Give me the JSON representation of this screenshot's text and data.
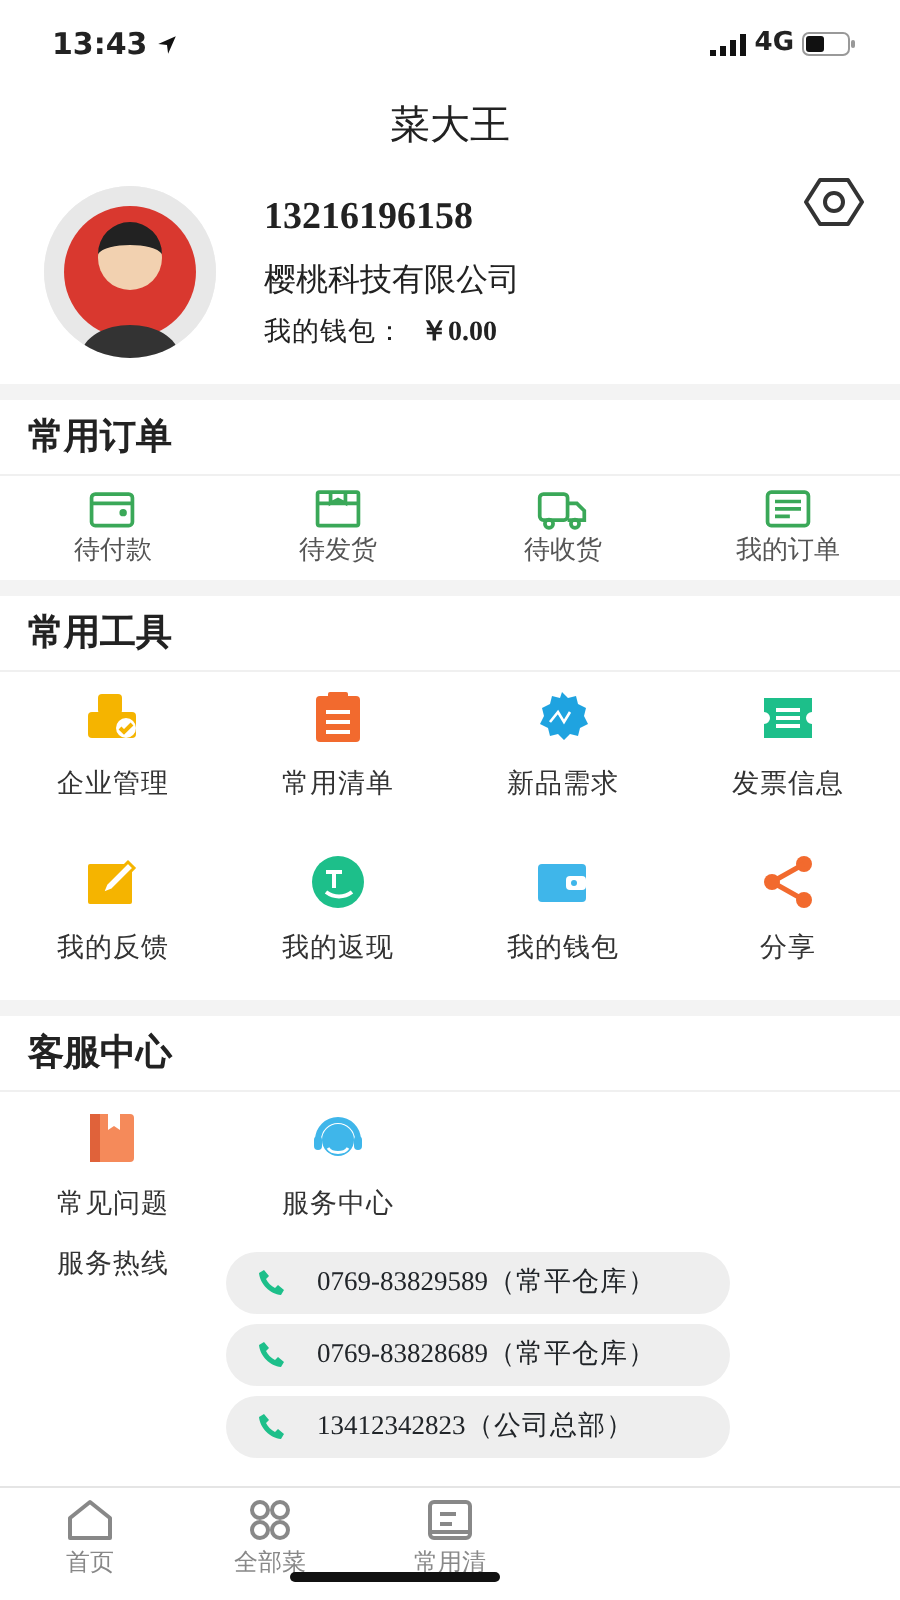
{
  "status_bar": {
    "time": "13:43",
    "network": "4G"
  },
  "title": "菜大王",
  "profile": {
    "phone": "13216196158",
    "company": "樱桃科技有限公司",
    "wallet_label": "我的钱包：",
    "wallet_value": "￥0.00"
  },
  "orders": {
    "heading": "常用订单",
    "items": [
      {
        "label": "待付款",
        "kind": "card"
      },
      {
        "label": "待发货",
        "kind": "box"
      },
      {
        "label": "待收货",
        "kind": "truck"
      },
      {
        "label": "我的订单",
        "kind": "list"
      }
    ]
  },
  "tools": {
    "heading": "常用工具",
    "items": [
      {
        "label": "企业管理",
        "kind": "building",
        "color": "#f5b400"
      },
      {
        "label": "常用清单",
        "kind": "clipboard",
        "color": "#f26a2e"
      },
      {
        "label": "新品需求",
        "kind": "new",
        "color": "#1fa3e0"
      },
      {
        "label": "发票信息",
        "kind": "ticket",
        "color": "#1dbf8a"
      },
      {
        "label": "我的反馈",
        "kind": "pencil",
        "color": "#f5b400"
      },
      {
        "label": "我的返现",
        "kind": "cashback",
        "color": "#1dbf8a"
      },
      {
        "label": "我的钱包",
        "kind": "wallet",
        "color": "#3fb6ea"
      },
      {
        "label": "分享",
        "kind": "share",
        "color": "#f26a2e"
      }
    ]
  },
  "service": {
    "heading": "客服中心",
    "items": [
      {
        "label": "常见问题",
        "kind": "book",
        "color": "#f58a5a"
      },
      {
        "label": "服务中心",
        "kind": "agent",
        "color": "#3fb6ea"
      }
    ],
    "hotline_label": "服务热线",
    "hotlines": [
      "0769-83829589（常平仓库）",
      "0769-83828689（常平仓库）",
      "13412342823（公司总部）"
    ]
  },
  "tab_bar": [
    {
      "label": "首页",
      "kind": "home",
      "selected": false
    },
    {
      "label": "全部菜",
      "kind": "grid",
      "selected": false
    },
    {
      "label": "常用清",
      "kind": "list",
      "selected": false
    }
  ]
}
